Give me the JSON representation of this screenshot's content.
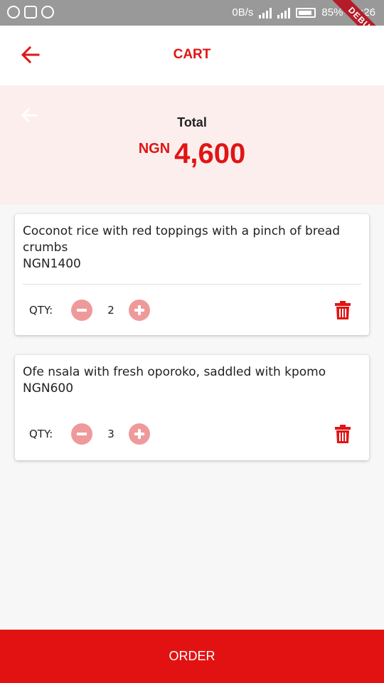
{
  "status_bar": {
    "net_speed": "0B/s",
    "battery": "85%",
    "time": "23:26",
    "debug_banner": "DEBUG"
  },
  "app_bar": {
    "title": "CART",
    "back_icon": "arrow-left-icon"
  },
  "total": {
    "label": "Total",
    "currency": "NGN",
    "amount": "4,600"
  },
  "cart": {
    "items": [
      {
        "name": "Coconot rice with red toppings with a pinch of bread crumbs",
        "price": "NGN1400",
        "qty_label": "QTY:",
        "qty": "2"
      },
      {
        "name": "Ofe nsala with fresh oporoko, saddled with kpomo",
        "price": "NGN600",
        "qty_label": "QTY:",
        "qty": "3"
      }
    ]
  },
  "order_button": {
    "label": "ORDER"
  },
  "colors": {
    "accent": "#e01515",
    "panel_bg": "#fdeeee",
    "qty_button": "#ef9a9a",
    "order_bg": "#e21212"
  }
}
